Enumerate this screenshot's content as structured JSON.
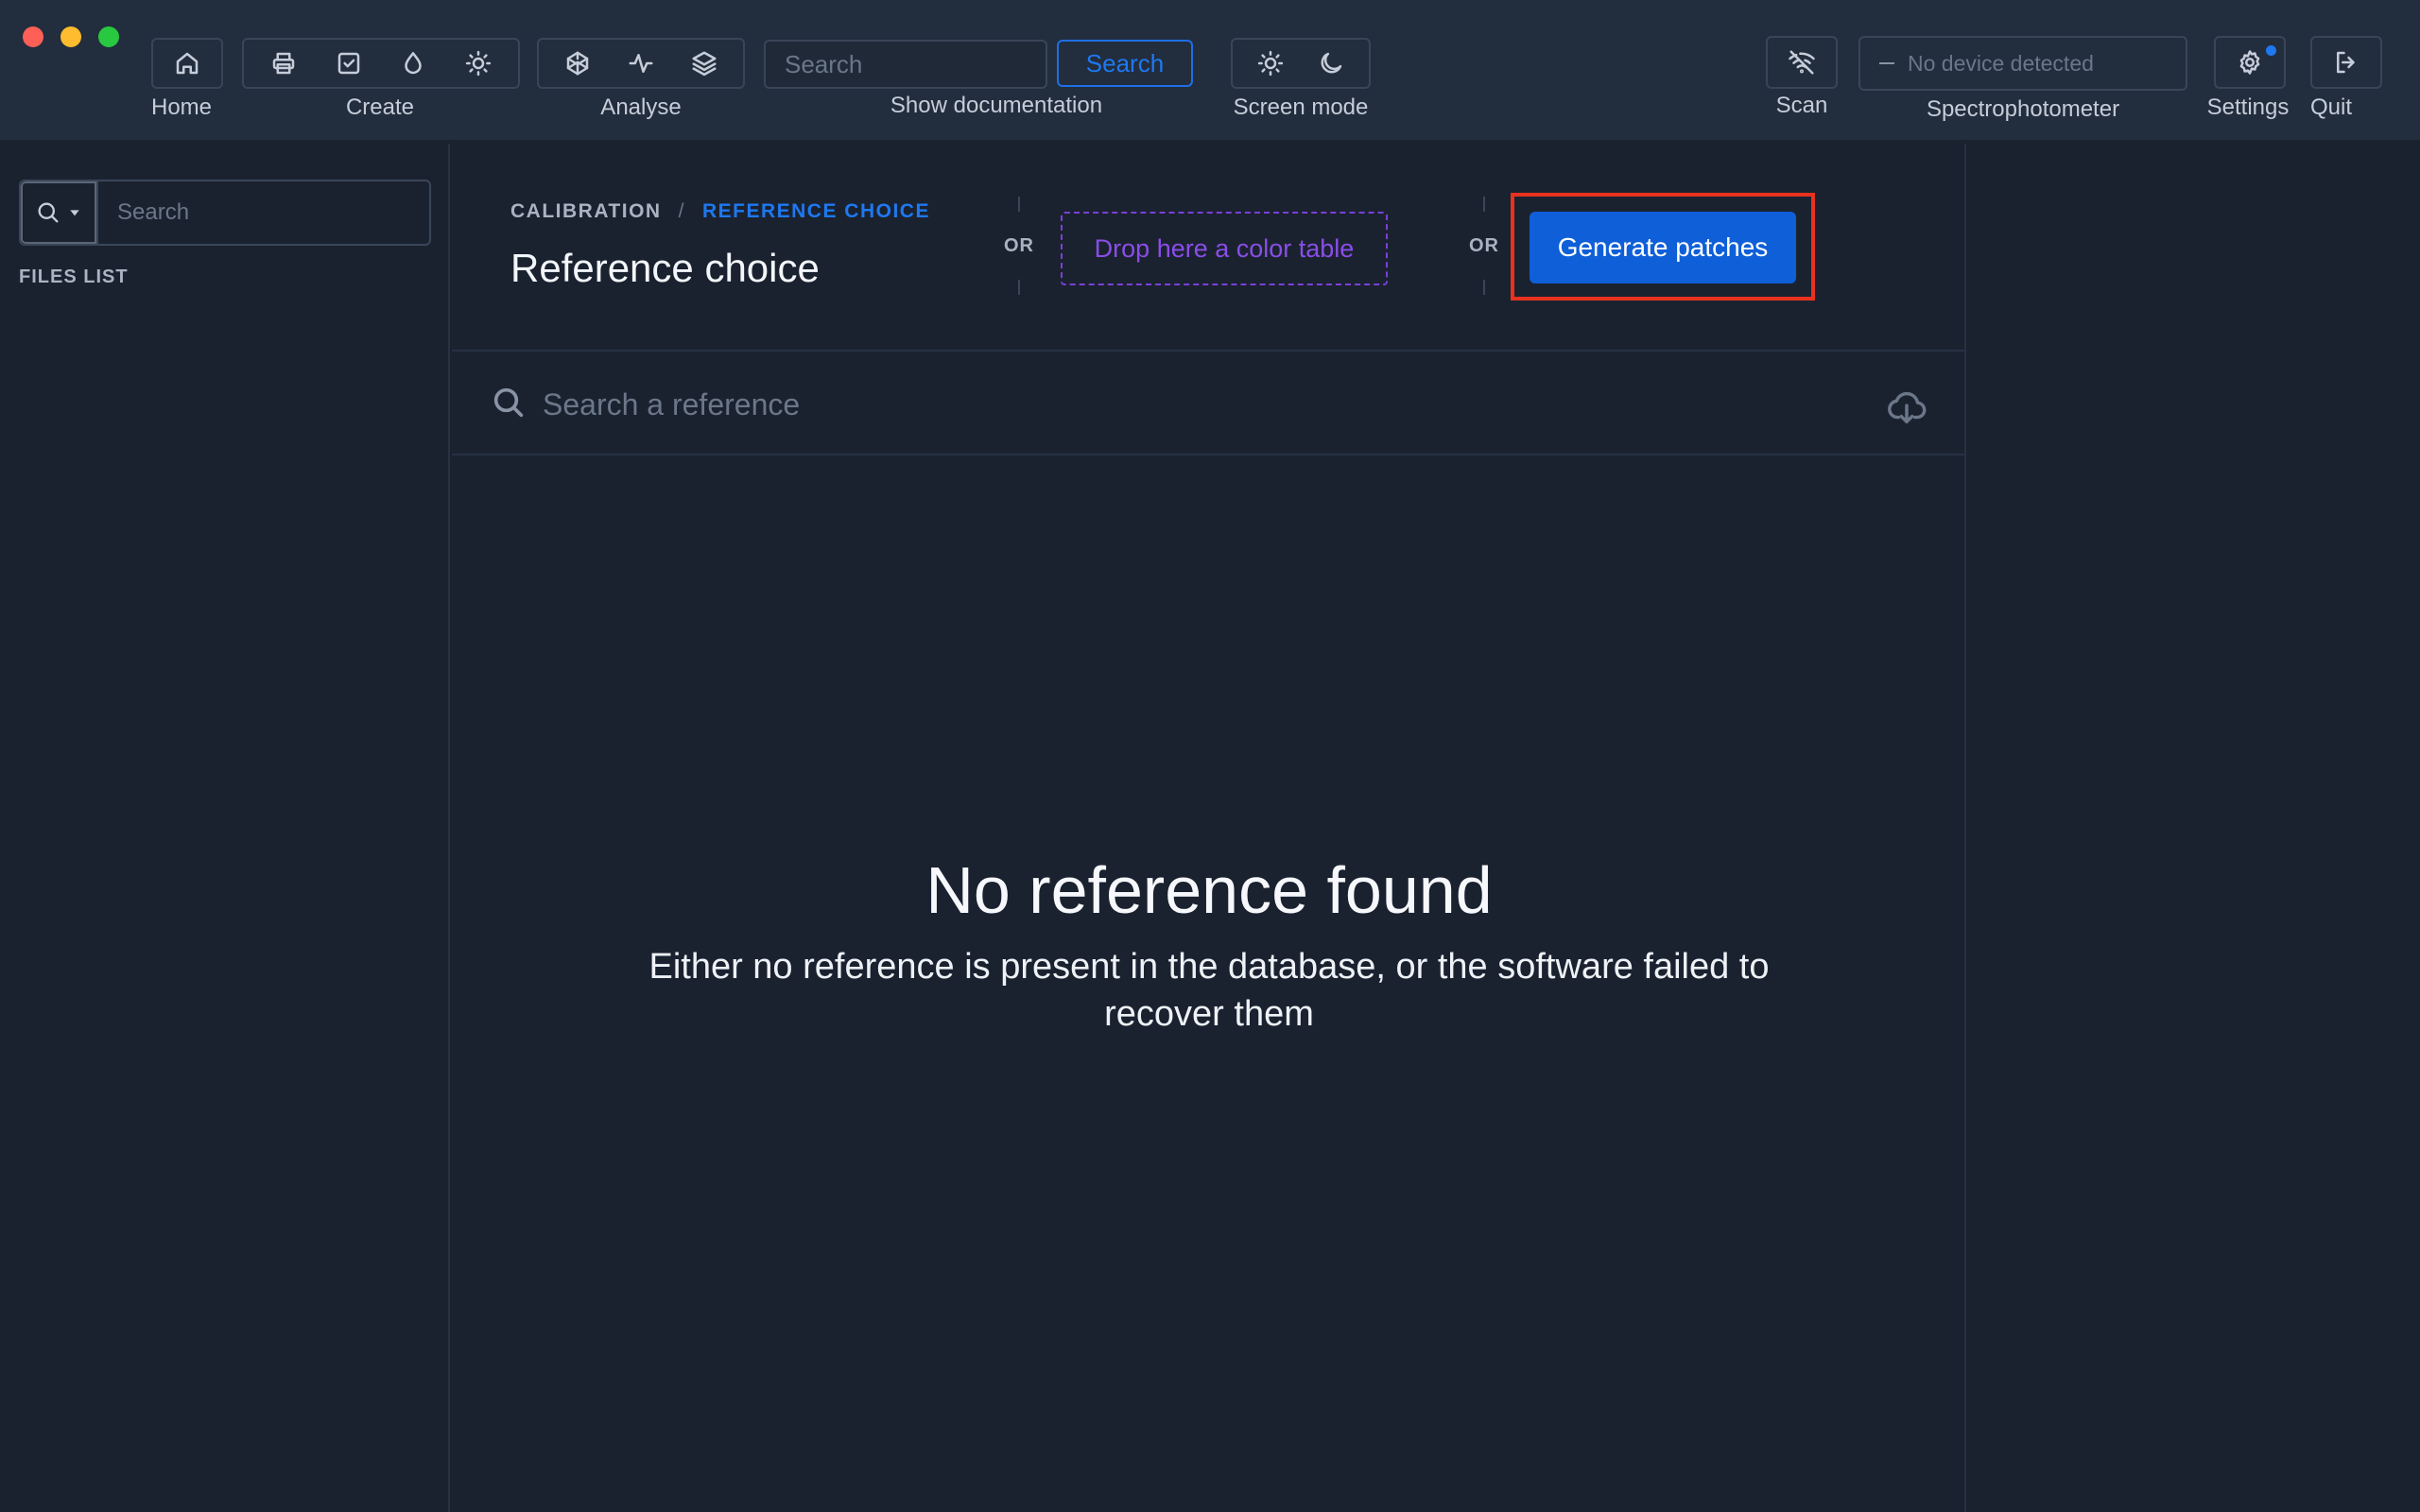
{
  "toolbar": {
    "home_label": "Home",
    "create_label": "Create",
    "analyse_label": "Analyse",
    "search_placeholder": "Search",
    "search_button": "Search",
    "show_documentation_label": "Show documentation",
    "screen_mode_label": "Screen mode",
    "scan_label": "Scan",
    "device_status": "No device detected",
    "spectrophotometer_label": "Spectrophotometer",
    "settings_label": "Settings",
    "quit_label": "Quit"
  },
  "sidebar": {
    "search_placeholder": "Search",
    "files_list_label": "FILES LIST"
  },
  "main": {
    "breadcrumb": {
      "first": "CALIBRATION",
      "separator": "/",
      "current": "REFERENCE CHOICE"
    },
    "title": "Reference choice",
    "or_label": "OR",
    "dropzone_label": "Drop here a color table",
    "generate_button": "Generate patches",
    "reference_search_placeholder": "Search a reference",
    "empty_title": "No reference found",
    "empty_text": "Either no reference is present in the database, or the software failed to recover them"
  },
  "colors": {
    "accent": "#1e78f0",
    "primary_button": "#0f5fd8",
    "dropzone": "#7b3fd8",
    "highlight": "#e8321e",
    "background": "#1a2230",
    "toolbar": "#222d3e"
  }
}
